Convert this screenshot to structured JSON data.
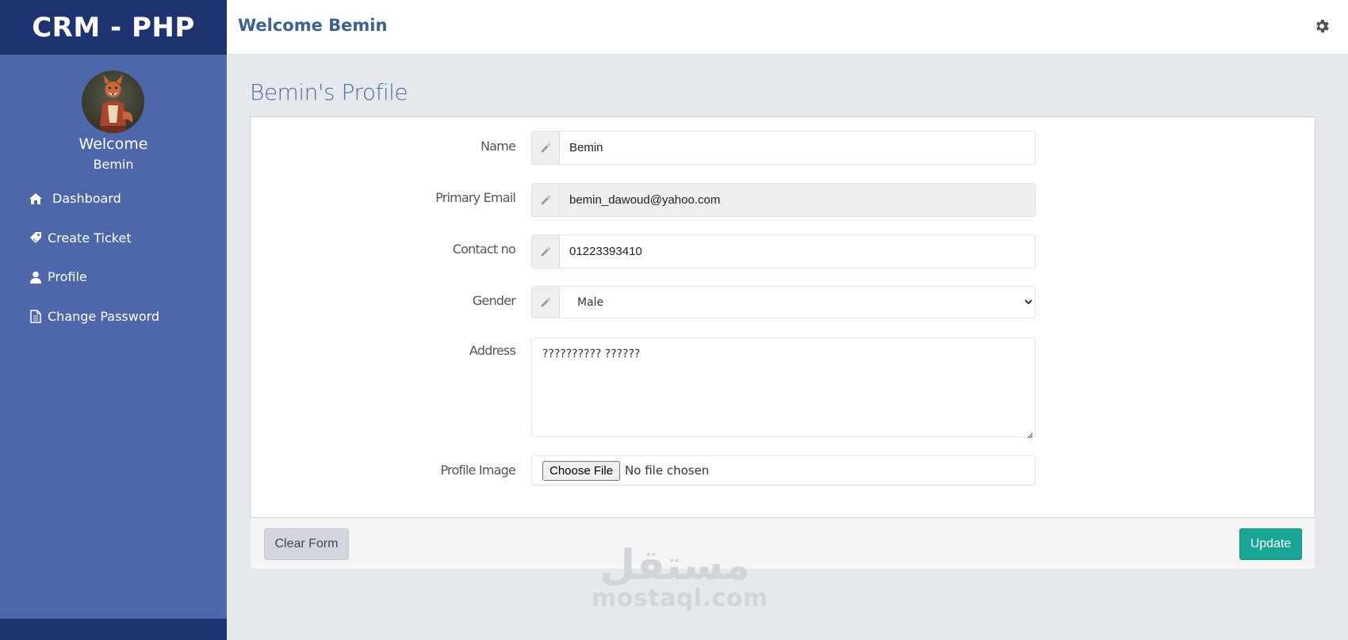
{
  "brand": "CRM - PHP",
  "sidebar": {
    "welcome": "Welcome",
    "username": "Bemin",
    "items": [
      {
        "label": "Dashboard",
        "icon": "home-icon"
      },
      {
        "label": "Create Ticket",
        "icon": "tag-icon"
      },
      {
        "label": "Profile",
        "icon": "user-icon"
      },
      {
        "label": "Change Password",
        "icon": "file-icon"
      }
    ]
  },
  "topbar": {
    "title": "Welcome Bemin",
    "settings_icon": "gear-icon"
  },
  "page": {
    "title": "Bemin's Profile"
  },
  "form": {
    "name": {
      "label": "Name",
      "value": "Bemin"
    },
    "email": {
      "label": "Primary Email",
      "value": "bemin_dawoud@yahoo.com"
    },
    "contact": {
      "label": "Contact no",
      "value": "01223393410"
    },
    "gender": {
      "label": "Gender",
      "value": "Male"
    },
    "address": {
      "label": "Address",
      "value": "?????????? ??????"
    },
    "profile_image": {
      "label": "Profile Image",
      "button": "Choose File",
      "status": "No file chosen"
    }
  },
  "actions": {
    "clear": "Clear Form",
    "update": "Update"
  },
  "watermark": {
    "arabic": "مستقل",
    "latin": "mostaql.com"
  },
  "colors": {
    "sidebar": "#4d67aa",
    "sidebar_dark": "#1f3370",
    "accent": "#3d6190",
    "update_button": "#17a595",
    "background": "#e5e9ed"
  }
}
